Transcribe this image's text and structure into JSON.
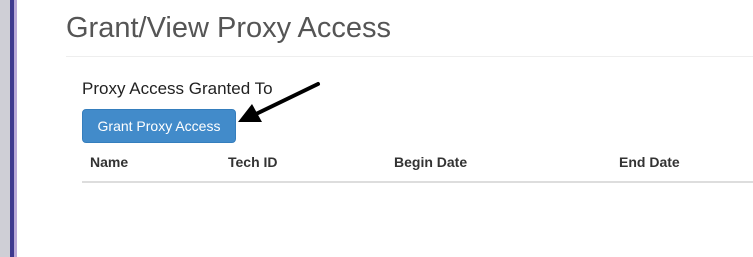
{
  "page": {
    "title": "Grant/View Proxy Access"
  },
  "proxy_section": {
    "heading": "Proxy Access Granted To",
    "grant_button_label": "Grant Proxy Access"
  },
  "table": {
    "columns": [
      "Name",
      "Tech ID",
      "Begin Date",
      "End Date"
    ],
    "rows": []
  },
  "colors": {
    "primary_button": "#428bca",
    "title_text": "#555555",
    "annotation_arrow": "#000000"
  },
  "icons": {
    "annotation": "arrow-icon"
  }
}
